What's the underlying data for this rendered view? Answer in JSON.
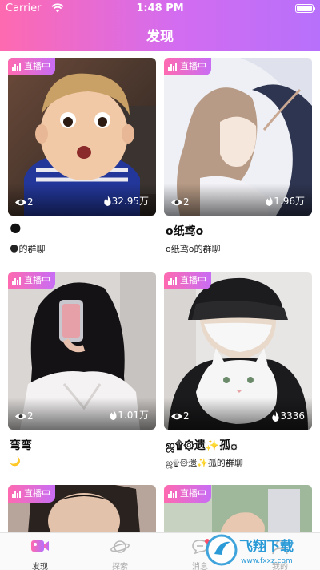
{
  "status": {
    "carrier": "Carrier",
    "time": "1:48 PM",
    "battery_level": 1.0
  },
  "header": {
    "title": "发现"
  },
  "live_label": "直播中",
  "cards": [
    {
      "viewers": "2",
      "heat": "32.95万",
      "name": "🌑",
      "group": "🌑的群聊"
    },
    {
      "viewers": "2",
      "heat": "1.96万",
      "name": "o纸鸢o",
      "group": "o纸鸢o的群聊"
    },
    {
      "viewers": "2",
      "heat": "1.01万",
      "name": "弯弯",
      "group": "🌙"
    },
    {
      "viewers": "2",
      "heat": "3336",
      "name": "ஜ۩۞遗✨孤۞",
      "group": "ஜ۩۞遗✨孤的群聊"
    },
    {
      "viewers": "",
      "heat": "",
      "name": "",
      "group": ""
    },
    {
      "viewers": "",
      "heat": "",
      "name": "",
      "group": ""
    }
  ],
  "tabs": [
    {
      "label": "发现",
      "icon": "video-camera-icon",
      "active": true
    },
    {
      "label": "探索",
      "icon": "planet-icon",
      "active": false
    },
    {
      "label": "消息",
      "icon": "chat-bubble-icon",
      "active": false
    },
    {
      "label": "我的",
      "icon": "profile-icon",
      "active": false
    }
  ],
  "watermark": {
    "text": "飞翔下载",
    "url": "www.fxxz.com"
  },
  "colors": {
    "accent_start": "#fe6ab0",
    "accent_end": "#b770fb",
    "heat_icon": "#ffffff"
  }
}
